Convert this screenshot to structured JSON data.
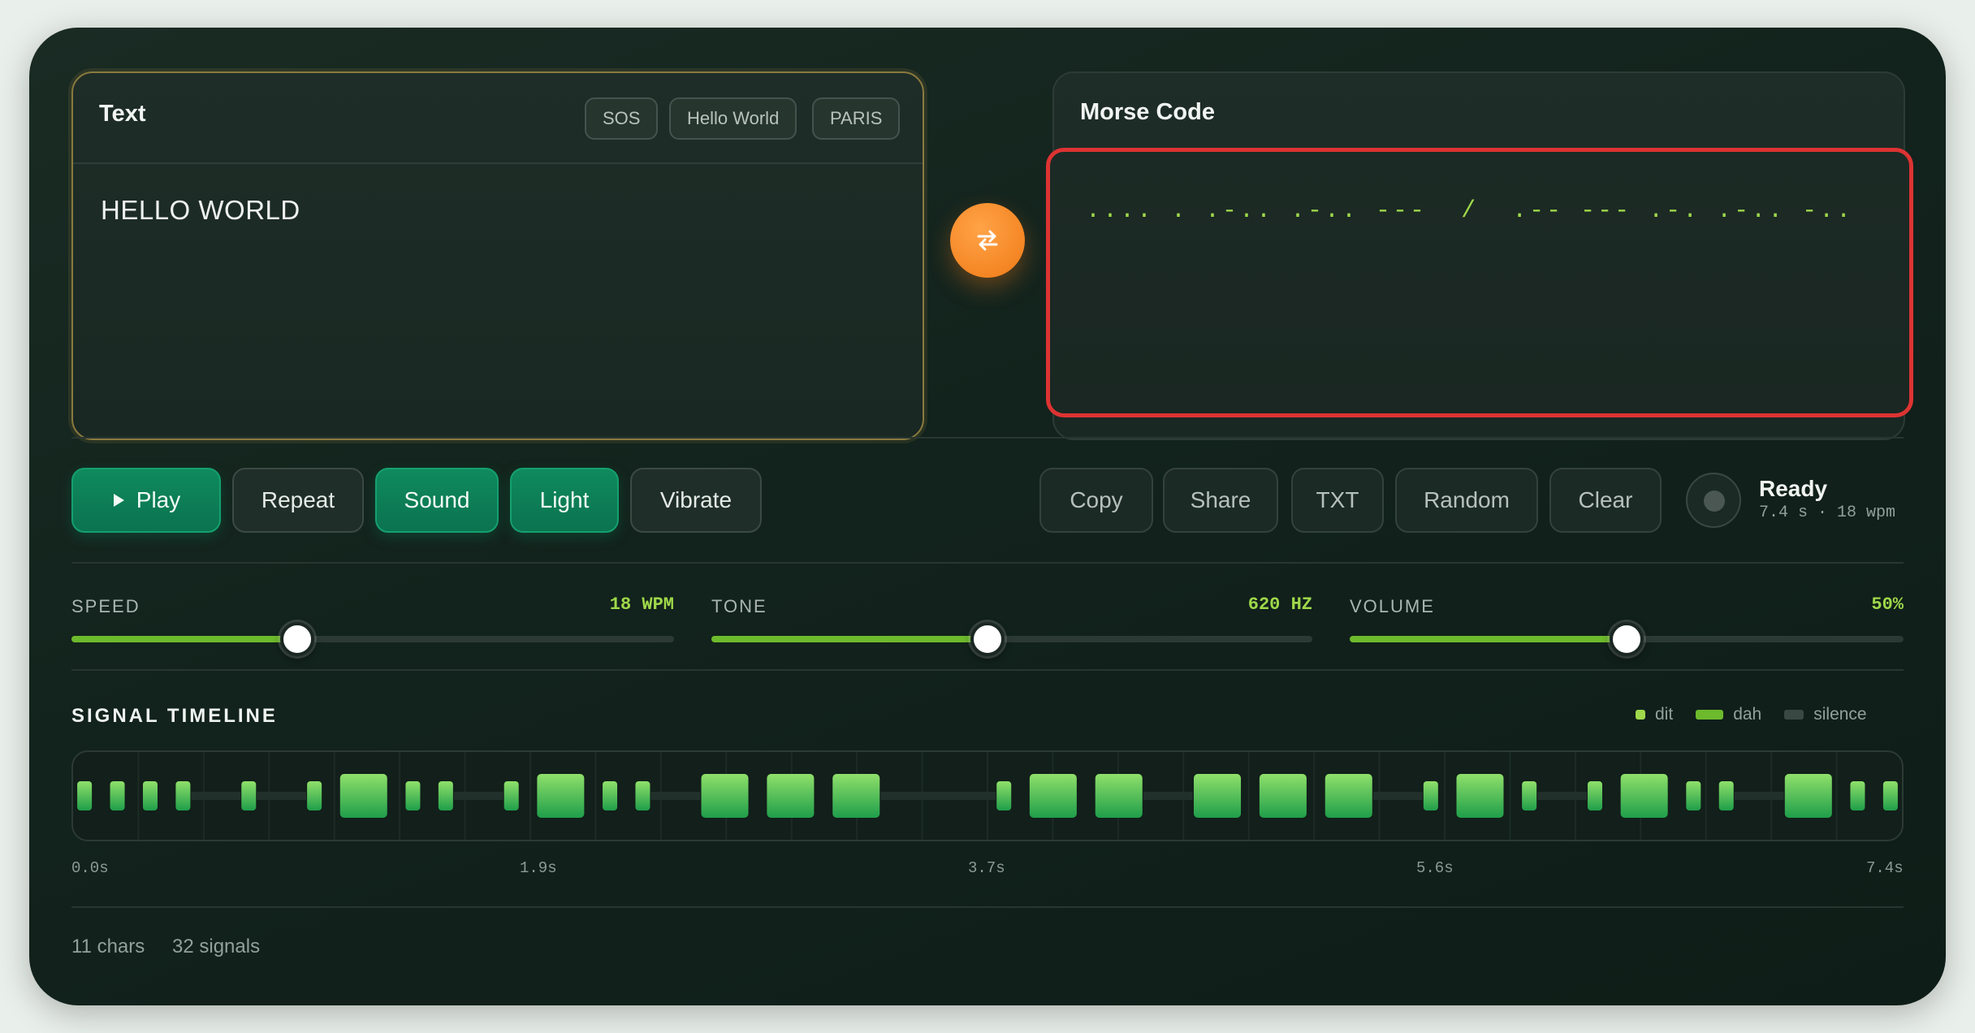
{
  "text_panel": {
    "title": "Text",
    "presets": [
      "SOS",
      "Hello World",
      "PARIS"
    ],
    "value": "HELLO WORLD"
  },
  "morse_panel": {
    "title": "Morse Code",
    "value": ".... . .-.. .-.. ---  /  .-- --- .-. .-.. -.."
  },
  "swap_icon": "swap-arrows-icon",
  "playback": {
    "play_label": "Play",
    "repeat_label": "Repeat",
    "sound_label": "Sound",
    "light_label": "Light",
    "vibrate_label": "Vibrate",
    "sound_active": true,
    "light_active": true
  },
  "actions": {
    "copy": "Copy",
    "share": "Share",
    "txt": "TXT",
    "random": "Random",
    "clear": "Clear"
  },
  "status": {
    "title": "Ready",
    "detail": "7.4 s · 18 wpm"
  },
  "sliders": {
    "speed": {
      "label": "SPEED",
      "display": "18 WPM",
      "level": 0.375
    },
    "tone": {
      "label": "TONE",
      "display": "620 HZ",
      "level": 0.46
    },
    "volume": {
      "label": "VOLUME",
      "display": "50%",
      "level": 0.5
    }
  },
  "timeline": {
    "title": "SIGNAL TIMELINE",
    "legend": {
      "dit": "dit",
      "dah": "dah",
      "silence": "silence"
    },
    "ticks": [
      "0.0s",
      "1.9s",
      "3.7s",
      "5.6s",
      "7.4s"
    ],
    "signals": ".... . .-.. .-.. --- / .-- --- .-. .-.. -.."
  },
  "footer": {
    "chars": "11 chars",
    "signals": "32 signals"
  },
  "colors": {
    "accent_green": "#9fd84a",
    "button_green": "#0f8a5e",
    "swap_orange": "#f07a16",
    "focus_red": "#dd3333",
    "text_border": "#8a7a3e"
  }
}
